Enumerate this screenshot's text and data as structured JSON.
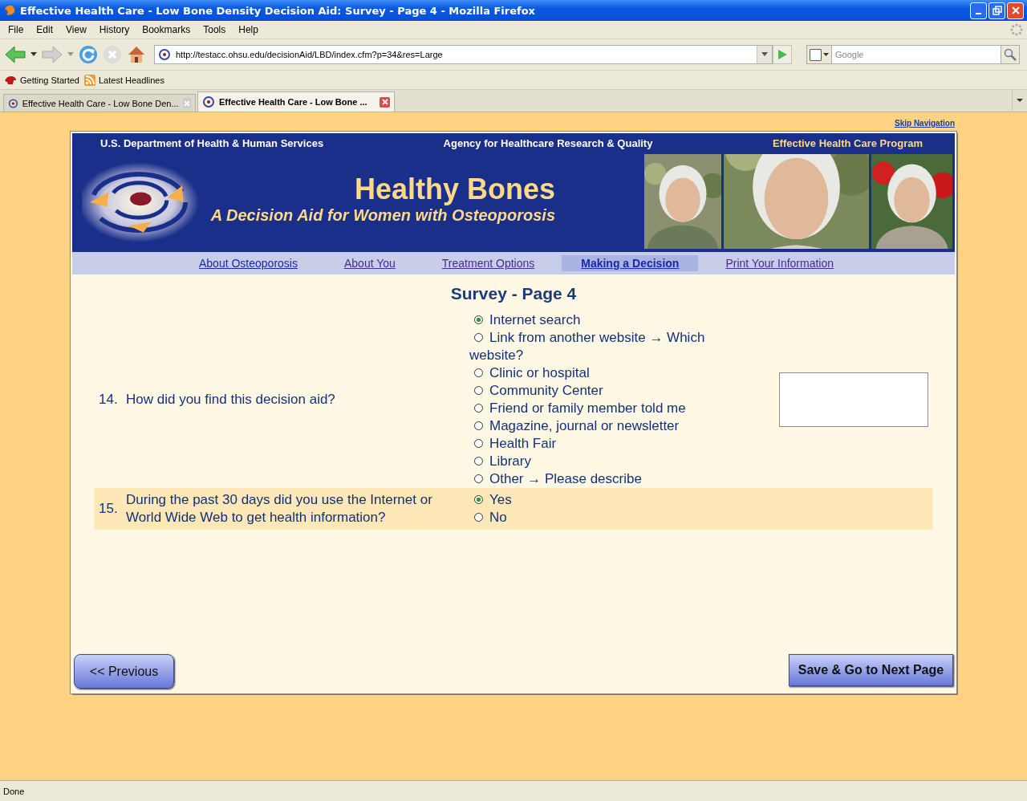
{
  "window": {
    "title": "Effective Health Care - Low Bone Density Decision Aid: Survey - Page 4 - Mozilla Firefox"
  },
  "menu": [
    "File",
    "Edit",
    "View",
    "History",
    "Bookmarks",
    "Tools",
    "Help"
  ],
  "toolbar": {
    "url": "http://testacc.ohsu.edu/decisionAid/LBD/index.cfm?p=34&res=Large",
    "search_placeholder": "Google"
  },
  "bookmarks": [
    "Getting Started",
    "Latest Headlines"
  ],
  "tabs": [
    {
      "label": "Effective Health Care - Low Bone Den...",
      "selected": false
    },
    {
      "label": "Effective Health Care - Low Bone ...",
      "selected": true
    }
  ],
  "page": {
    "skip_link": "Skip Navigation",
    "agencies": [
      "U.S. Department of Health & Human Services",
      "Agency for Healthcare Research & Quality",
      "Effective Health Care Program"
    ],
    "title": "Healthy Bones",
    "subtitle": "A Decision Aid for Women with Osteoporosis",
    "nav": [
      {
        "label": "About Osteoporosis",
        "visited": false,
        "selected": false
      },
      {
        "label": "About You",
        "visited": true,
        "selected": false
      },
      {
        "label": "Treatment Options",
        "visited": true,
        "selected": false
      },
      {
        "label": "Making a Decision",
        "visited": false,
        "selected": true
      },
      {
        "label": "Print Your Information",
        "visited": true,
        "selected": false
      }
    ],
    "survey_title": "Survey - Page 4",
    "questions": [
      {
        "number": "14.",
        "text": "How did you find this decision aid?",
        "has_text_field": true,
        "options": [
          {
            "label": "Internet search",
            "selected": true
          },
          {
            "label": "Link from another website → Which website?",
            "selected": false
          },
          {
            "label": "Clinic or hospital",
            "selected": false
          },
          {
            "label": "Community Center",
            "selected": false
          },
          {
            "label": "Friend or family member told me",
            "selected": false
          },
          {
            "label": "Magazine, journal or newsletter",
            "selected": false
          },
          {
            "label": "Health Fair",
            "selected": false
          },
          {
            "label": "Library",
            "selected": false
          },
          {
            "label": "Other → Please describe",
            "selected": false
          }
        ]
      },
      {
        "number": "15.",
        "text": "During the past 30 days did you use the Internet or World Wide Web to get health information?",
        "has_text_field": false,
        "options": [
          {
            "label": "Yes",
            "selected": true
          },
          {
            "label": "No",
            "selected": false
          }
        ]
      }
    ],
    "previous_button": "<< Previous",
    "next_button": "Save & Go to Next Page"
  },
  "status_bar": "Done"
}
